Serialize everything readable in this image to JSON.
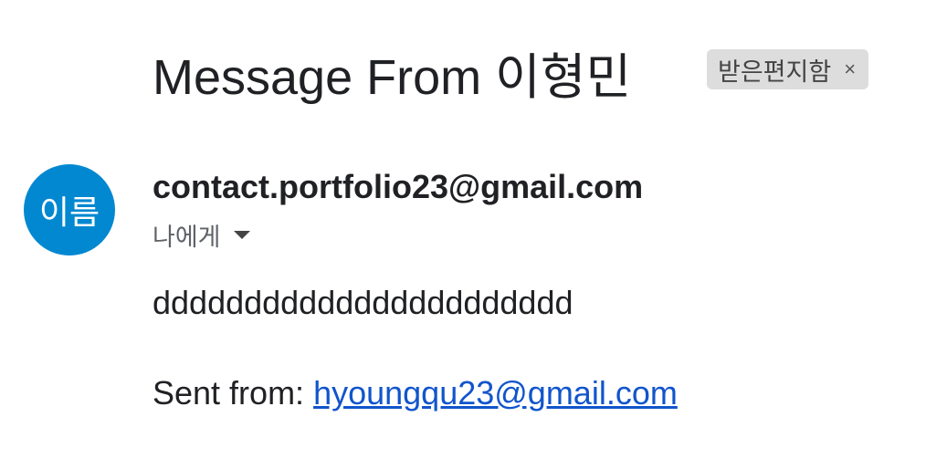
{
  "subject": "Message From 이형민",
  "label": {
    "text": "받은편지함",
    "remove": "×"
  },
  "avatar_text": "이름",
  "sender": "contact.portfolio23@gmail.com",
  "recipient": "나에게",
  "body": "ddddddddddddddddddddddd",
  "sent_from_label": "Sent from: ",
  "sent_from_email": "hyoungqu23@gmail.com"
}
